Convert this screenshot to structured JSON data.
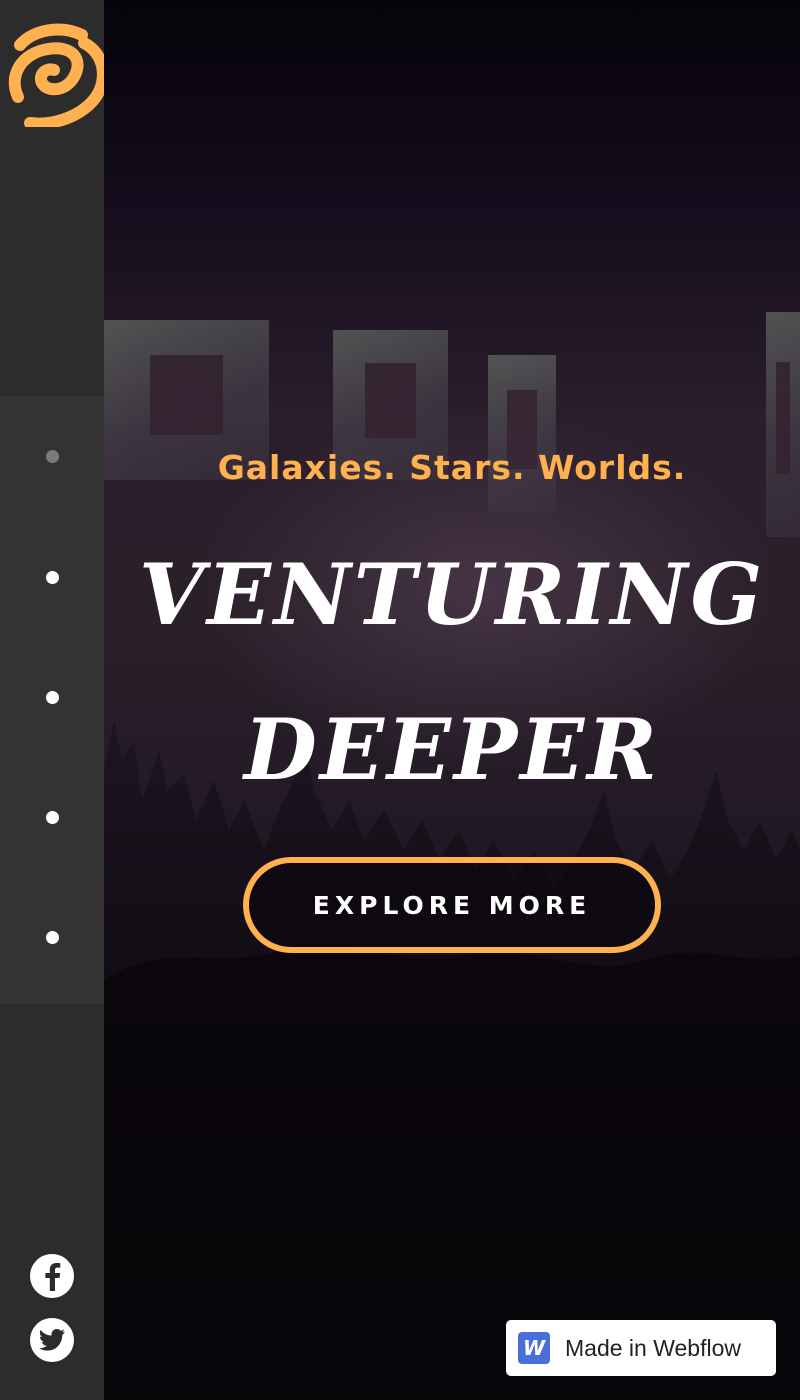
{
  "sidebar": {
    "logo_icon": "swirl-logo-icon",
    "accent_color": "#ffb14f",
    "nav_dots": [
      {
        "name": "section-1",
        "active": true
      },
      {
        "name": "section-2",
        "active": false
      },
      {
        "name": "section-3",
        "active": false
      },
      {
        "name": "section-4",
        "active": false
      },
      {
        "name": "section-5",
        "active": false
      }
    ],
    "social": [
      "facebook-icon",
      "twitter-icon"
    ]
  },
  "hero": {
    "tagline": "Galaxies. Stars. Worlds.",
    "headline_line1": "Venturing",
    "headline_line2": "deeper",
    "cta_label": "EXPLORE MORE"
  },
  "badge": {
    "logo_letter": "W",
    "label": "Made in Webflow"
  }
}
